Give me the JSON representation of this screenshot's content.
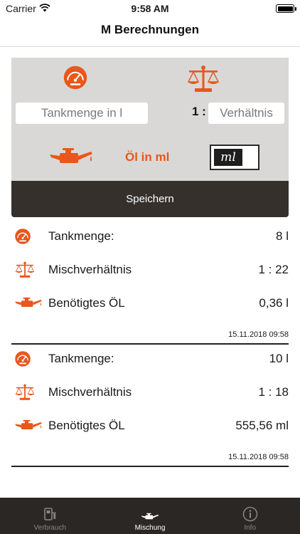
{
  "status_bar": {
    "carrier": "Carrier",
    "time": "9:58 AM"
  },
  "nav": {
    "title": "M Berechnungen"
  },
  "form": {
    "tank_placeholder": "Tankmenge in l",
    "ratio_prefix": "1 :",
    "ratio_placeholder": "Verhältnis",
    "oil_label": "Öl in  ml",
    "unit_toggle": "ml",
    "save_label": "Speichern"
  },
  "records": [
    {
      "tank_label": "Tankmenge:",
      "tank_value": "8 l",
      "ratio_label": "Mischverhältnis",
      "ratio_value": "1 : 22",
      "oil_label": "Benötigtes ÖL",
      "oil_value": "0,36 l",
      "timestamp": "15.11.2018 09:58"
    },
    {
      "tank_label": "Tankmenge:",
      "tank_value": "10 l",
      "ratio_label": "Mischverhältnis",
      "ratio_value": "1 : 18",
      "oil_label": "Benötigtes ÖL",
      "oil_value": "555,56 ml",
      "timestamp": "15.11.2018 09:58"
    }
  ],
  "tabs": [
    {
      "label": "Verbrauch",
      "icon": "fuel-pump-icon",
      "active": false
    },
    {
      "label": "Mischung",
      "icon": "oil-can-icon",
      "active": true
    },
    {
      "label": "Info",
      "icon": "info-icon",
      "active": false
    }
  ],
  "colors": {
    "accent": "#e8571c",
    "panel": "#d9d8d6",
    "button": "#35302c",
    "tab_bar": "#2b2724"
  }
}
